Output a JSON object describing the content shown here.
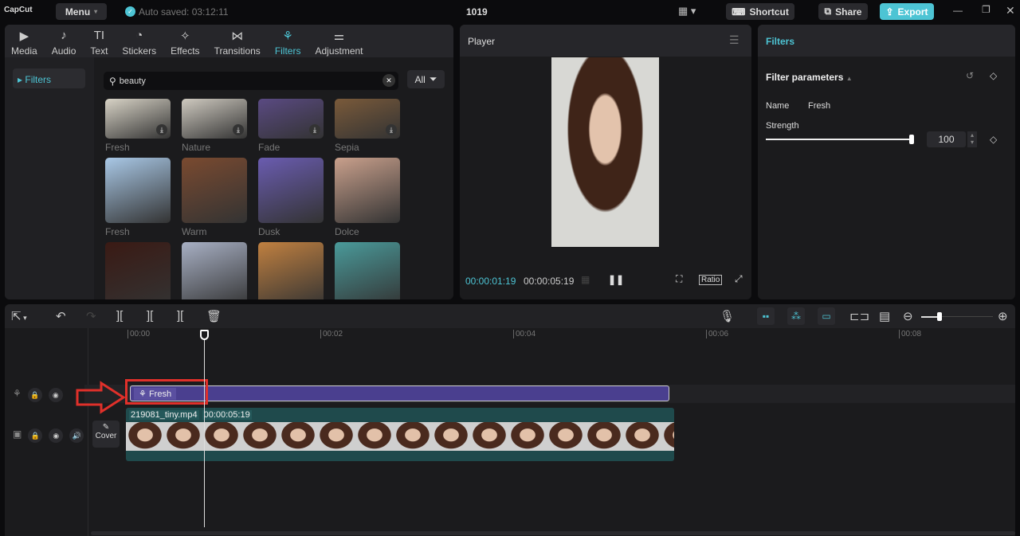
{
  "app": {
    "logo": "CapCut",
    "menu": "Menu",
    "autosave": "Auto saved: 03:12:11",
    "project": "1019",
    "shortcut": "Shortcut",
    "share": "Share",
    "export": "Export",
    "accent": "#4dc4d4"
  },
  "tabs": [
    {
      "label": "Media",
      "icon": "▶"
    },
    {
      "label": "Audio",
      "icon": "♪"
    },
    {
      "label": "Text",
      "icon": "TI"
    },
    {
      "label": "Stickers",
      "icon": "◔"
    },
    {
      "label": "Effects",
      "icon": "✧"
    },
    {
      "label": "Transitions",
      "icon": "⋈"
    },
    {
      "label": "Filters",
      "icon": "⚘"
    },
    {
      "label": "Adjustment",
      "icon": "⚌"
    }
  ],
  "sidebar": {
    "item": "Filters"
  },
  "search": {
    "value": "beauty",
    "all": "All"
  },
  "filters": [
    {
      "label": "Fresh",
      "c": "#d8d3c6"
    },
    {
      "label": "Nature",
      "c": "#cfcac0"
    },
    {
      "label": "Fade",
      "c": "#5a4a82"
    },
    {
      "label": "Sepia",
      "c": "#7a5a3a"
    },
    {
      "label": "Fresh",
      "c": "#a9c8e6"
    },
    {
      "label": "Warm",
      "c": "#7a4a30"
    },
    {
      "label": "Dusk",
      "c": "#6a5cb0"
    },
    {
      "label": "Dolce",
      "c": "#c9a08c"
    },
    {
      "label": "",
      "c": "#3a1a14"
    },
    {
      "label": "",
      "c": "#a8b0c4"
    },
    {
      "label": "",
      "c": "#c08040"
    },
    {
      "label": "",
      "c": "#4a9a9a"
    }
  ],
  "player": {
    "title": "Player",
    "current": "00:00:01:19",
    "total": "00:00:05:19",
    "ratio": "Ratio"
  },
  "inspector": {
    "title": "Filters",
    "section": "Filter parameters",
    "name_label": "Name",
    "name_value": "Fresh",
    "strength_label": "Strength",
    "strength_value": "100",
    "strength_fraction": 1.0
  },
  "timeline": {
    "ticks": [
      "00:00",
      "00:02",
      "00:04",
      "00:06",
      "00:08"
    ],
    "playhead_seconds": 0.81,
    "filter_clip": "Fresh",
    "video_name": "219081_tiny.mp4",
    "video_duration": "00:00:05:19",
    "cover": "Cover",
    "zoom_fraction": 0.25
  }
}
